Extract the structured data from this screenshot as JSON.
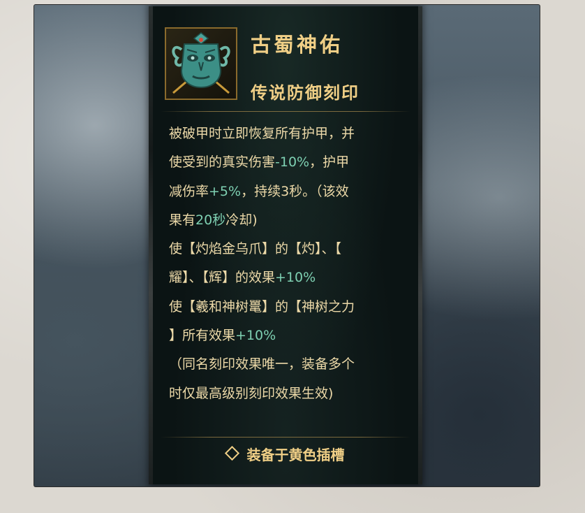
{
  "tooltip": {
    "title": "古蜀神佑",
    "subtitle": "传说防御刻印",
    "icon": "bronze-mask-icon",
    "equip_slot": "装备于黄色插槽",
    "lines": [
      {
        "t1": "被破甲时立即恢复所有护甲，并",
        "hl": "",
        "t2": ""
      },
      {
        "t1": "使受到的真实伤害",
        "hl": "-10%",
        "t2": "，护甲"
      },
      {
        "t1": "减伤率",
        "hl": "+5%",
        "t2": "，持续3秒。（该效"
      },
      {
        "t1": "果有",
        "hl": "20秒",
        "t2": "冷却)"
      },
      {
        "t1": "使【灼焰金乌爪】的【灼】、【",
        "hl": "",
        "t2": ""
      },
      {
        "t1": "耀】、【辉】的效果",
        "hl": "+10%",
        "t2": ""
      },
      {
        "t1": "使【羲和神树鼍】的【神树之力",
        "hl": "",
        "t2": ""
      },
      {
        "t1": "】所有效果",
        "hl": "+10%",
        "t2": ""
      },
      {
        "t1": "（同名刻印效果唯一，装备多个",
        "hl": "",
        "t2": ""
      },
      {
        "t1": "时仅最高级别刻印效果生效)",
        "hl": "",
        "t2": ""
      }
    ]
  },
  "colors": {
    "gold_text": "#f0cf86",
    "body_text": "#ecd9a8",
    "highlight": "#7ed0b2",
    "panel_bg": "#0b1414"
  }
}
